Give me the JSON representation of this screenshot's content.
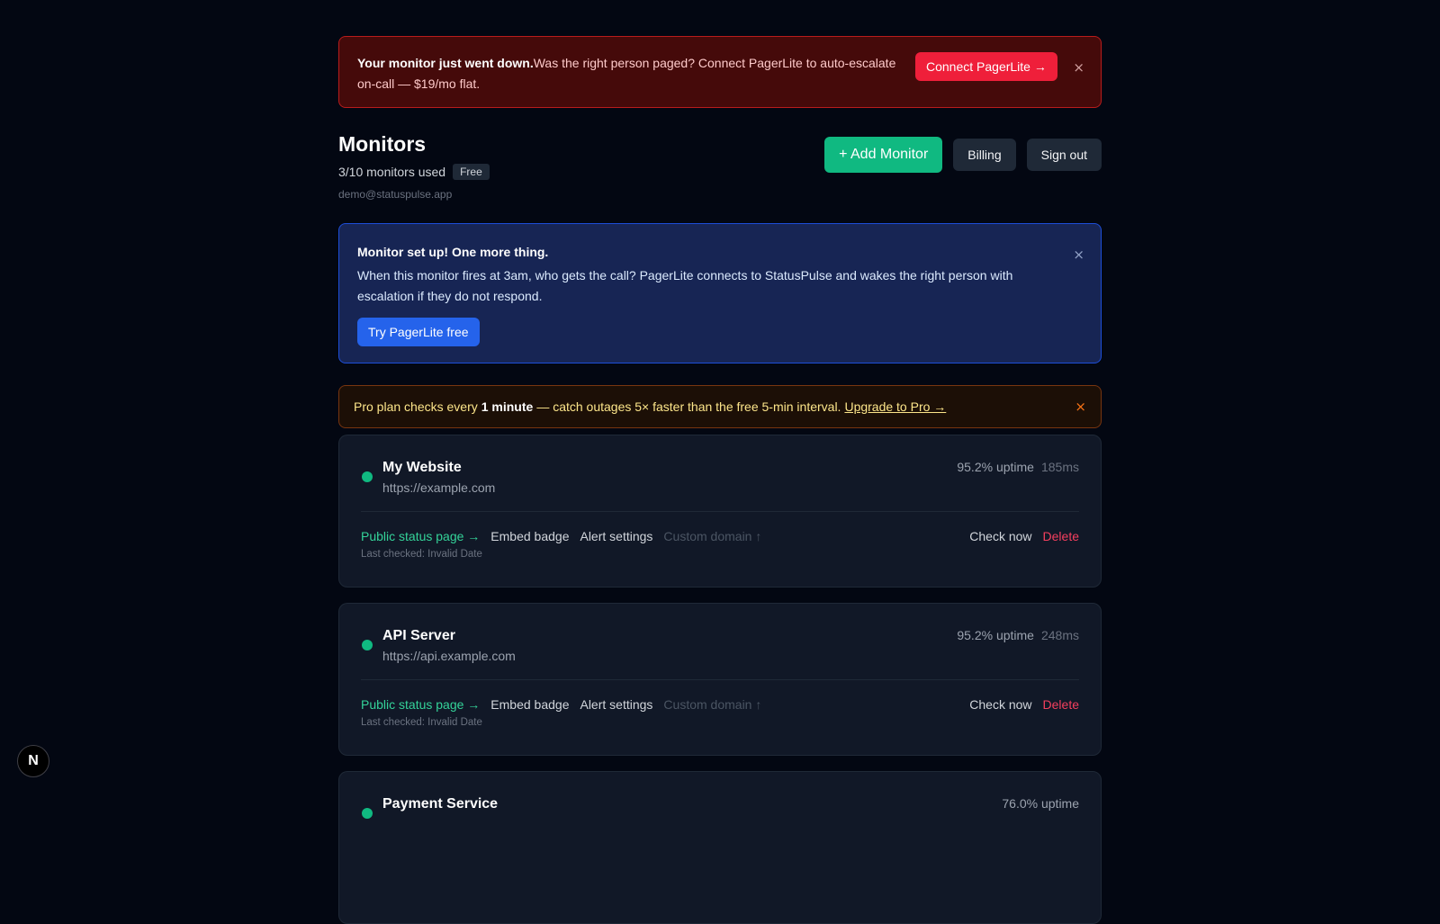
{
  "alert": {
    "title": "Your monitor just went down.",
    "message": "Was the right person paged? Connect PagerLite to auto-escalate on-call — $19/mo flat.",
    "button": "Connect PagerLite →",
    "close": "×"
  },
  "header": {
    "title": "Monitors",
    "usage": "3/10 monitors used",
    "plan": "Free",
    "email": "demo@statuspulse.app",
    "add_button": "+ Add Monitor",
    "billing_button": "Billing",
    "signout_button": "Sign out"
  },
  "onboarding": {
    "title": "Monitor set up! One more thing.",
    "body": "When this monitor fires at 3am, who gets the call? PagerLite connects to StatusPulse and wakes the right person with escalation if they do not respond.",
    "button": "Try PagerLite free",
    "close": "×"
  },
  "upgrade": {
    "pre": "Pro plan checks every",
    "bold": "1 minute",
    "post": "— catch outages 5× faster than the free 5-min interval.",
    "link": "Upgrade to Pro →",
    "close": "×"
  },
  "monitors": [
    {
      "name": "My Website",
      "url": "https://example.com",
      "uptime": "95.2% uptime",
      "latency": "185ms",
      "status_color": "#10b981",
      "public_page": "Public status page →",
      "embed": "Embed badge",
      "alerts": "Alert settings",
      "custom_domain": "Custom domain ↑",
      "check_now": "Check now",
      "delete": "Delete",
      "last_checked": "Last checked: Invalid Date"
    },
    {
      "name": "API Server",
      "url": "https://api.example.com",
      "uptime": "95.2% uptime",
      "latency": "248ms",
      "status_color": "#10b981",
      "public_page": "Public status page →",
      "embed": "Embed badge",
      "alerts": "Alert settings",
      "custom_domain": "Custom domain ↑",
      "check_now": "Check now",
      "delete": "Delete",
      "last_checked": "Last checked: Invalid Date"
    },
    {
      "name": "Payment Service",
      "uptime": "76.0% uptime"
    }
  ],
  "nextjs_badge": "N",
  "colors": {
    "accent_green": "#10b981",
    "danger_red": "#ef1f3a",
    "primary_blue": "#2563eb"
  }
}
